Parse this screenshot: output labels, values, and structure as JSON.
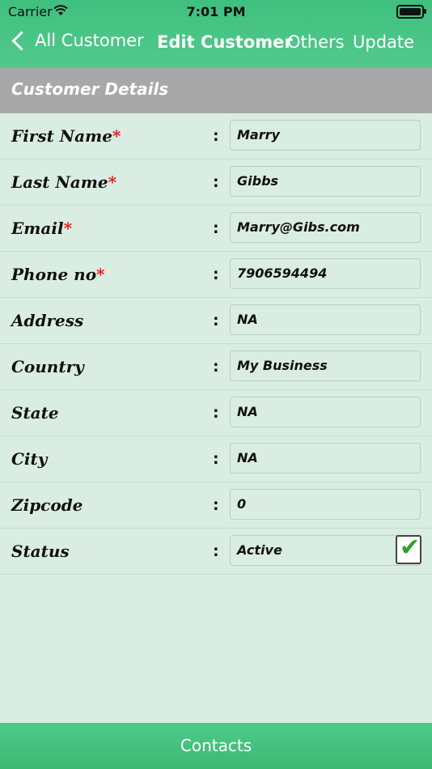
{
  "status_bar": {
    "carrier": "Carrier",
    "time": "7:01 PM"
  },
  "nav": {
    "back_label": "All Customer",
    "title": "Edit Customer",
    "others_label": "Others",
    "update_label": "Update"
  },
  "section_title": "Customer Details",
  "separator": ":",
  "fields": [
    {
      "label": "First Name",
      "required": "*",
      "value": "Marry"
    },
    {
      "label": "Last Name",
      "required": "*",
      "value": "Gibbs"
    },
    {
      "label": "Email",
      "required": "*",
      "value": "Marry@Gibs.com"
    },
    {
      "label": "Phone no",
      "required": "*",
      "value": "7906594494"
    },
    {
      "label": "Address",
      "required": "",
      "value": "NA"
    },
    {
      "label": "Country",
      "required": "",
      "value": "My Business"
    },
    {
      "label": "State",
      "required": "",
      "value": "NA"
    },
    {
      "label": "City",
      "required": "",
      "value": "NA"
    },
    {
      "label": "Zipcode",
      "required": "",
      "value": "0"
    },
    {
      "label": "Status",
      "required": "",
      "value": "Active"
    }
  ],
  "status_checkbox_glyph": "✔",
  "bottom_button": {
    "label": "Contacts"
  },
  "colors": {
    "accent": "#4cc487",
    "background": "#d9ede3",
    "section": "#a8a8a8",
    "required": "#ee1111",
    "check": "#2ea32e"
  }
}
